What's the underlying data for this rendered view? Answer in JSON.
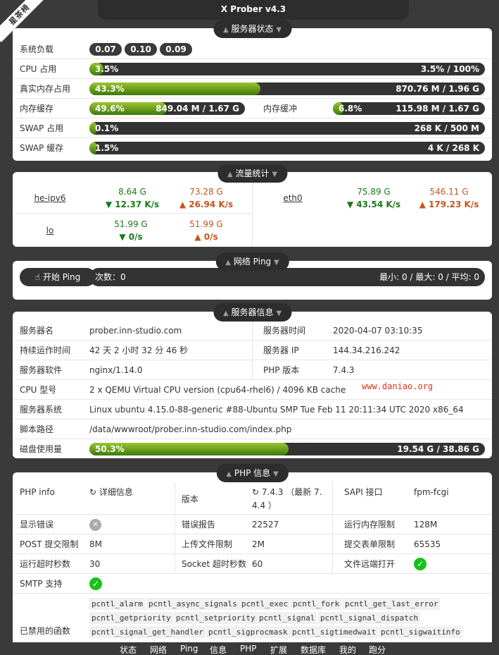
{
  "corner": "星茶椅",
  "title": "X Prober v4.3",
  "status": {
    "caption": "服务器状态",
    "load_label": "系统负载",
    "load": [
      "0.07",
      "0.10",
      "0.09"
    ],
    "cpu": {
      "label": "CPU 占用",
      "pct": "3.5%",
      "value": "3.5% / 100%",
      "percent": 3.5
    },
    "mem": {
      "label": "真实内存占用",
      "pct": "43.3%",
      "value": "870.76 M / 1.96 G",
      "percent": 43.3
    },
    "cache": {
      "label": "内存缓存",
      "pct": "49.6%",
      "value": "849.04 M / 1.67 G",
      "percent": 49.6
    },
    "buffer": {
      "label": "内存缓冲",
      "pct": "6.8%",
      "value": "115.98 M / 1.67 G",
      "percent": 6.8
    },
    "swap": {
      "label": "SWAP 占用",
      "pct": "0.1%",
      "value": "268 K / 500 M",
      "percent": 0.1
    },
    "swap_cache": {
      "label": "SWAP 缓存",
      "pct": "1.5%",
      "value": "4 K / 268 K",
      "percent": 1.5
    }
  },
  "network": {
    "caption": "流量统计",
    "interfaces": [
      {
        "name": "he-ipv6",
        "rx_total": "8.64 G",
        "rx_rate": "▼ 12.37 K/s",
        "tx_total": "73.28 G",
        "tx_rate": "▲ 26.94 K/s"
      },
      {
        "name": "eth0",
        "rx_total": "75.89 G",
        "rx_rate": "▼ 43.54 K/s",
        "tx_total": "546.11 G",
        "tx_rate": "▲ 179.23 K/s"
      },
      {
        "name": "lo",
        "rx_total": "51.99 G",
        "rx_rate": "▼ 0/s",
        "tx_total": "51.99 G",
        "tx_rate": "▲ 0/s"
      }
    ]
  },
  "ping": {
    "caption": "网络 Ping",
    "button": "开始 Ping",
    "count": "次数：0",
    "stats": "最小: 0 / 最大: 0 / 平均: 0"
  },
  "server": {
    "caption": "服务器信息",
    "name_label": "服务器名",
    "name": "prober.inn-studio.com",
    "time_label": "服务器时间",
    "time": "2020-04-07 03:10:35",
    "uptime_label": "持续运作时间",
    "uptime": "42 天 2 小时 32 分 46 秒",
    "ip_label": "服务器 IP",
    "ip": "144.34.216.242",
    "software_label": "服务器软件",
    "software": "nginx/1.14.0",
    "php_label": "PHP 版本",
    "php": "7.4.3",
    "cpu_label": "CPU 型号",
    "cpu": "2 x QEMU Virtual CPU version (cpu64-rhel6) / 4096 KB cache",
    "os_label": "服务器系统",
    "os": "Linux ubuntu 4.15.0-88-generic #88-Ubuntu SMP Tue Feb 11 20:11:34 UTC 2020 x86_64",
    "path_label": "脚本路径",
    "path": "/data/wwwroot/prober.inn-studio.com/index.php",
    "disk_label": "磁盘使用量",
    "disk_pct": "50.3%",
    "disk": "19.54 G / 38.86 G",
    "disk_percent": 50.3
  },
  "watermark": "www.daniao.org",
  "php": {
    "caption": "PHP 信息",
    "info_label": "PHP info",
    "info_value": "详细信息",
    "version_label": "版本",
    "version_line1": "7.4.3 （最新 7.",
    "version_line2": "4.4 ）",
    "sapi_label": "SAPI 接口",
    "sapi": "fpm-fcgi",
    "display_errors_label": "显示错误",
    "error_report_label": "错误报告",
    "error_report": "22527",
    "memory_limit_label": "运行内存限制",
    "memory_limit": "128M",
    "post_max_label": "POST 提交限制",
    "post_max": "8M",
    "upload_label": "上传文件限制",
    "upload": "2M",
    "form_max_label": "提交表单限制",
    "form_max": "65535",
    "exec_time_label": "运行超时秒数",
    "exec_time": "30",
    "socket_label": "Socket 超时秒数",
    "socket": "60",
    "remote_open_label": "文件远端打开",
    "smtp_label": "SMTP 支持",
    "disabled_label": "已禁用的函数",
    "disabled_functions": [
      "pcntl_alarm",
      "pcntl_async_signals",
      "pcntl_exec",
      "pcntl_fork",
      "pcntl_get_last_error",
      "pcntl_getpriority",
      "pcntl_setpriority",
      "pcntl_signal",
      "pcntl_signal_dispatch",
      "pcntl_signal_get_handler",
      "pcntl_sigprocmask",
      "pcntl_sigtimedwait",
      "pcntl_sigwaitinfo"
    ]
  },
  "footer": [
    "状态",
    "网络",
    "Ping",
    "信息",
    "PHP",
    "扩展",
    "数据库",
    "我的",
    "跑分"
  ]
}
